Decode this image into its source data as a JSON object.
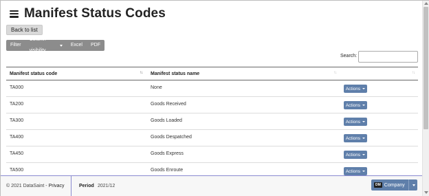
{
  "header": {
    "title": "Manifest Status Codes",
    "back_label": "Back to list"
  },
  "toolbar": {
    "filter": "Filter",
    "column_visibility": "Column visibility",
    "excel": "Excel",
    "pdf": "PDF"
  },
  "search": {
    "label": "Search:",
    "value": ""
  },
  "table": {
    "columns": [
      "Manifest status code",
      "Manifest status name",
      ""
    ],
    "sort_icon": "↑↓",
    "actions_label": "Actions",
    "rows": [
      {
        "code": "TA000",
        "name": "None"
      },
      {
        "code": "TA200",
        "name": "Goods Received"
      },
      {
        "code": "TA300",
        "name": "Goods Loaded"
      },
      {
        "code": "TA400",
        "name": "Goods Despatched"
      },
      {
        "code": "TA450",
        "name": "Goods Express"
      },
      {
        "code": "TA500",
        "name": "Goods Enroute"
      }
    ]
  },
  "footer": {
    "copyright": "© 2021 DataSaint - ",
    "privacy": "Privacy",
    "period_label": "Period",
    "period_value": "2021/12",
    "company_logo": "DM",
    "company_label": "Company"
  },
  "colors": {
    "accent": "#5f7faa",
    "toolbar": "#8c8c8c",
    "footer_border": "#8a8ad0"
  }
}
